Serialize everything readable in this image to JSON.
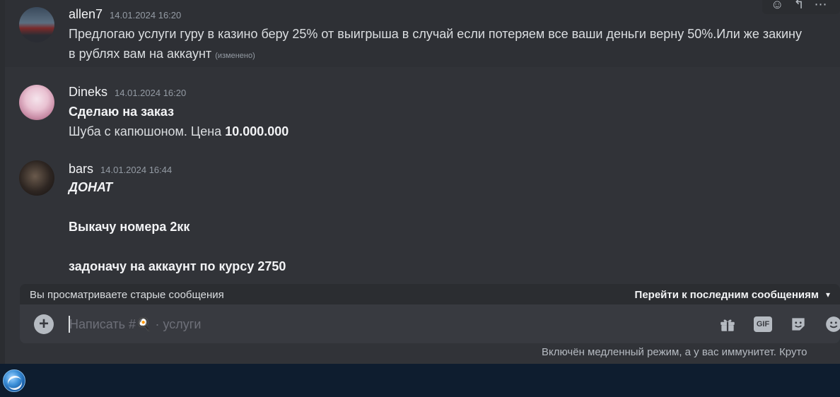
{
  "messages": [
    {
      "username": "allen7",
      "timestamp": "14.01.2024 16:20",
      "lines": [
        "Предлогаю услуги гуру в казино беру 25% от выигрыша в случай если потеряем все ваши деньги верну 50%.Или же закину в рублях вам на аккаунт"
      ],
      "edited": "(изменено)"
    },
    {
      "username": "Dineks",
      "timestamp": "14.01.2024 16:20",
      "title": "Сделаю на заказ",
      "body_prefix": "Шуба с капюшоном. Цена ",
      "body_price": "10.000.000"
    },
    {
      "username": "bars",
      "timestamp": "14.01.2024 16:44",
      "heading": "ДОНАТ",
      "line1": "Выкачу номера 2кк",
      "line2": "задоначу на аккаунт  по курсу 2750"
    }
  ],
  "banner": {
    "left_text": "Вы просматриваете старые сообщения",
    "right_text": "Перейти к последним сообщениям"
  },
  "composer": {
    "placeholder": "Написать #🍳 · услуги"
  },
  "slowmode_text": "Включён медленный режим, а у вас иммунитет. Круто",
  "colors": {
    "background": "#313338",
    "composer": "#383a40",
    "banner": "#2b2d31",
    "taskbar": "#0e1d2f"
  }
}
